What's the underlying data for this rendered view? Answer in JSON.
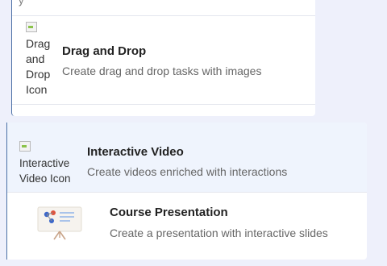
{
  "top_strip": {
    "text": "y"
  },
  "drag_drop": {
    "alt_text": "Drag and Drop Icon",
    "alt_lines": [
      "Drag",
      "and",
      "Drop",
      "Icon"
    ],
    "title": "Drag and Drop",
    "description": "Create drag and drop tasks with images",
    "icon": "broken-image-icon"
  },
  "interactive_video": {
    "alt_lines": [
      "Interactive",
      "Video Icon"
    ],
    "title": "Interactive Video",
    "description": "Create videos enriched with interactions",
    "icon": "broken-image-icon"
  },
  "course_presentation": {
    "title": "Course Presentation",
    "description": "Create a presentation with interactive slides",
    "icon": "presentation-easel-icon"
  },
  "colors": {
    "background": "#eef0fb",
    "card": "#ffffff",
    "selected_row": "#eff4fd",
    "border_accent": "#4a6fa5"
  }
}
